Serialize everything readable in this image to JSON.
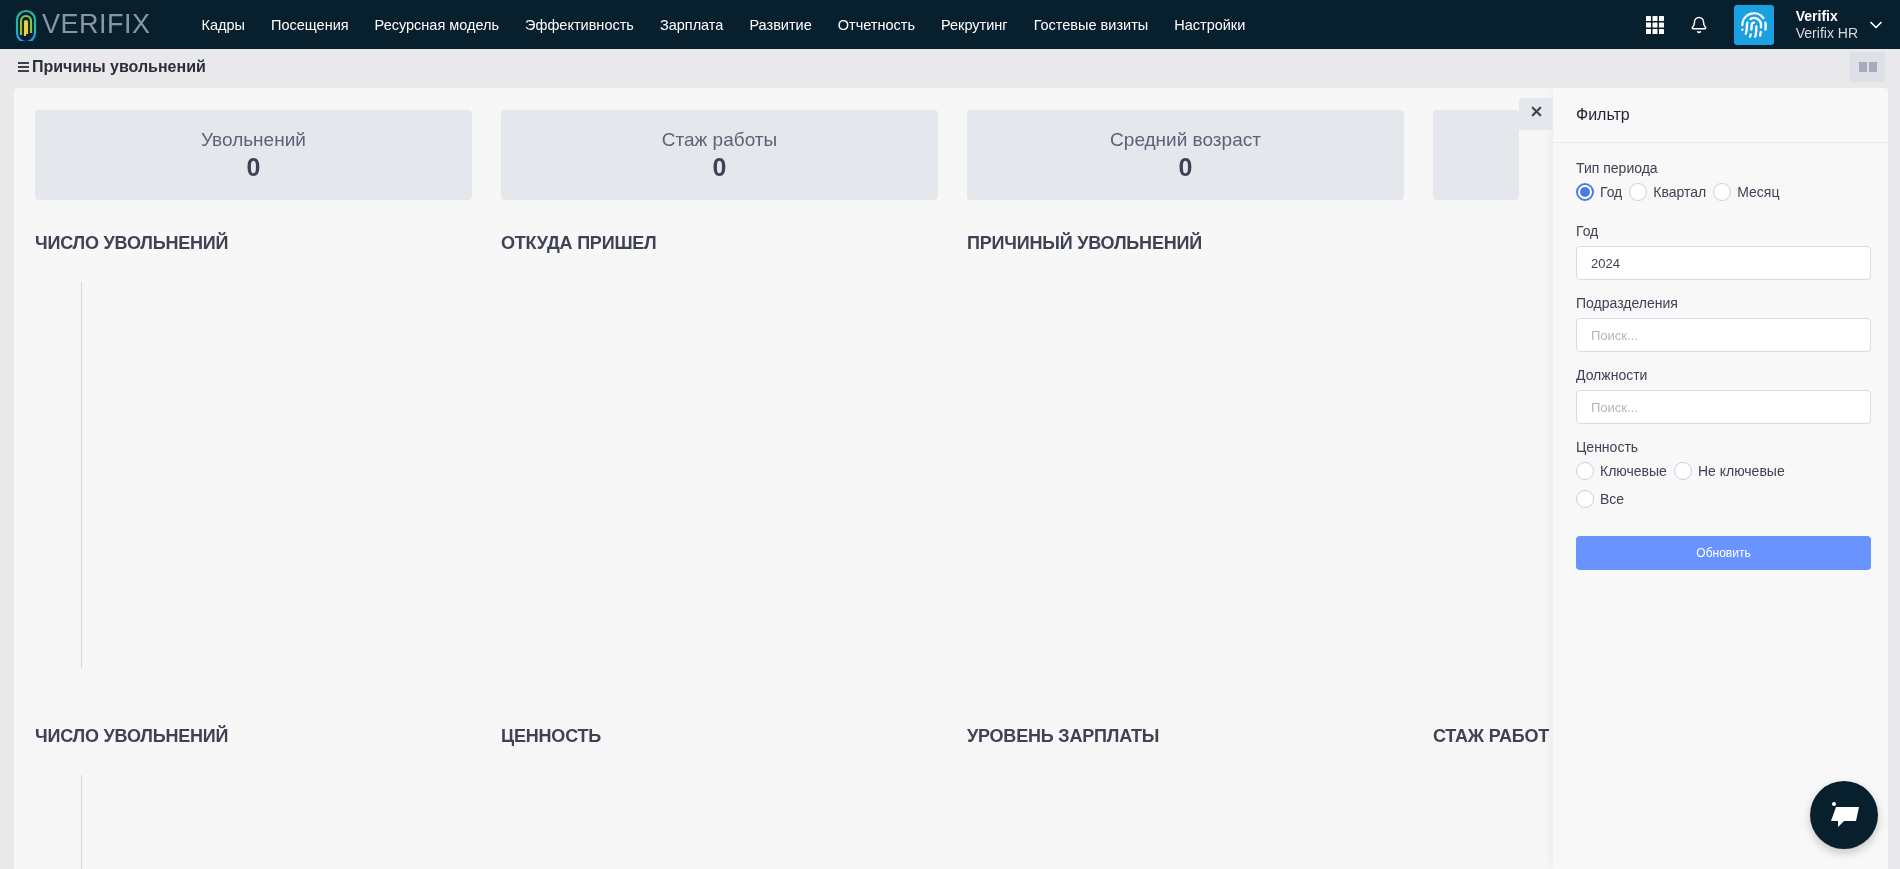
{
  "nav": {
    "logo_text": "VERIFIX",
    "menu": [
      "Кадры",
      "Посещения",
      "Ресурсная модель",
      "Эффективность",
      "Зарплата",
      "Развитие",
      "Отчетность",
      "Рекрутинг",
      "Гостевые визиты",
      "Настройки"
    ],
    "user": {
      "name": "Verifix",
      "org": "Verifix HR"
    }
  },
  "page": {
    "title": "Причины увольнений"
  },
  "stats": [
    {
      "label": "Увольнений",
      "value": "0"
    },
    {
      "label": "Стаж работы",
      "value": "0"
    },
    {
      "label": "Средний возраст",
      "value": "0"
    }
  ],
  "chart_rows": [
    [
      {
        "title": "ЧИСЛО УВОЛЬНЕНИЙ",
        "axis": true
      },
      {
        "title": "ОТКУДА ПРИШЕЛ",
        "axis": false
      },
      {
        "title": "ПРИЧИНЫЙ УВОЛЬНЕНИЙ",
        "axis": false
      }
    ],
    [
      {
        "title": "ЧИСЛО УВОЛЬНЕНИЙ",
        "axis": true
      },
      {
        "title": "ЦЕННОСТЬ",
        "axis": false
      },
      {
        "title": "УРОВЕНЬ ЗАРПЛАТЫ",
        "axis": false
      },
      {
        "title": "СТАЖ РАБОТ",
        "axis": false
      }
    ]
  ],
  "filter": {
    "title": "Фильтр",
    "period_label": "Тип периода",
    "period_options": [
      {
        "label": "Год",
        "selected": true
      },
      {
        "label": "Квартал",
        "selected": false
      },
      {
        "label": "Месяц",
        "selected": false
      }
    ],
    "year_label": "Год",
    "year_value": "2024",
    "departments_label": "Подразделения",
    "departments_placeholder": "Поиск...",
    "positions_label": "Должности",
    "positions_placeholder": "Поиск...",
    "value_label": "Ценность",
    "value_options": [
      {
        "label": "Ключевые",
        "selected": false
      },
      {
        "label": "Не ключевые",
        "selected": false
      },
      {
        "label": "Все",
        "selected": false
      }
    ],
    "button": "Обновить"
  }
}
